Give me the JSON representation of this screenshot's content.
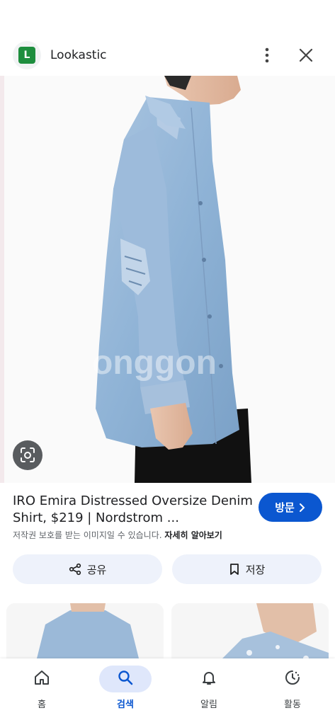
{
  "header": {
    "site_initial": "L",
    "site_name": "Lookastic"
  },
  "product": {
    "title": "IRO Emira Distressed Oversize Denim Shirt, $219 | Nordstrom ...",
    "visit_label": "방문",
    "copyright_text": "저작권 보호를 받는 이미지일 수 있습니다. ",
    "copyright_more": "자세히 알아보기",
    "watermark": "onggon"
  },
  "actions": {
    "share_label": "공유",
    "save_label": "저장"
  },
  "bottom_nav": {
    "items": [
      {
        "label": "홈",
        "icon": "home-icon"
      },
      {
        "label": "검색",
        "icon": "search-icon",
        "active": true
      },
      {
        "label": "알림",
        "icon": "bell-icon"
      },
      {
        "label": "활동",
        "icon": "activity-icon"
      }
    ]
  },
  "colors": {
    "accent": "#0b57d0",
    "site_logo": "#1e8e3e",
    "denim": "#8fb3d6"
  }
}
